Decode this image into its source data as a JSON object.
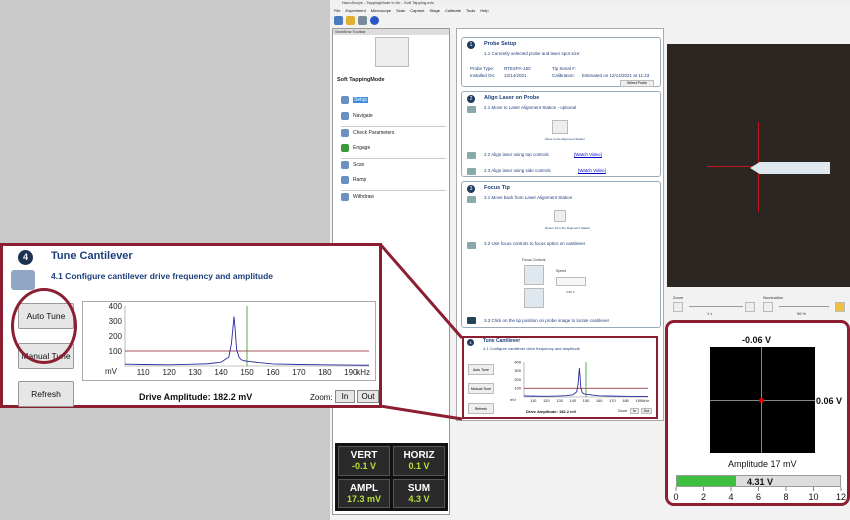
{
  "app": {
    "title": "NanoScope - TappingMode in Air - Soft Tapping.edc"
  },
  "menu": [
    "File",
    "Experiment",
    "Microscope",
    "Scan",
    "Capture",
    "Stage",
    "Calibrate",
    "Tools",
    "Help"
  ],
  "workflow": {
    "header": "Workflow Toolbar",
    "title": "Soft TappingMode",
    "items": [
      "Setup",
      "Navigate",
      "Check Parameters",
      "Engage",
      "Scan",
      "Ramp",
      "Withdraw"
    ]
  },
  "readouts": [
    {
      "label": "VERT",
      "value": "-0.1  V"
    },
    {
      "label": "HORIZ",
      "value": "0.1  V"
    },
    {
      "label": "AMPL",
      "value": "17.3  mV"
    },
    {
      "label": "SUM",
      "value": "4.3  V"
    }
  ],
  "steps": {
    "s1": {
      "num": "1",
      "title": "Probe Setup",
      "t1": "1.1 Currently selected probe and laser spot size:",
      "type_label": "Probe Type:",
      "type_value": "RTESPA-150",
      "serial_label": "Tip Serial #:",
      "inst_label": "Installed On:",
      "inst_value": "12/14/2021",
      "cal_label": "Calibration:",
      "cal_value": "Estimated on 12/14/2021 at 11:23",
      "select": "Select Probe"
    },
    "s2": {
      "num": "2",
      "title": "Align Laser on Probe",
      "t1": "2.1 Move to Laser Alignment Station - optional",
      "move": "Move to the Alignment Station",
      "t2": "2.2 Align laser using top controls",
      "t3": "2.3 Align laser using side controls",
      "video": "[Watch Video]"
    },
    "s3": {
      "num": "3",
      "title": "Focus Tip",
      "t1": "3.1 Move back from Laser Alignment Station",
      "ret": "Return from the Alignment Station",
      "t2": "3.2 Use focus controls to focus optics on cantilever",
      "fc": "Focus Controls",
      "speed": "Speed",
      "speedval": "2.00 X",
      "t3": "3.3 Click on the tip position on probe image to locate cantilever"
    },
    "s4": {
      "num": "4",
      "title": "Tune Cantilever",
      "t1": "4.1 Configure cantilever drive frequency and amplitude",
      "auto": "Auto Tune",
      "manual": "Manual Tune",
      "refresh": "Refresh",
      "drive": "Drive Amplitude: 182.2 mV",
      "zoom": "Zoom:",
      "in": "In",
      "out": "Out"
    }
  },
  "zoom": {
    "zoom_label": "Zoom",
    "zoom_val": "1 x",
    "illum_label": "Illumination",
    "illum_val": "96 %"
  },
  "panel": {
    "top": "-0.06 V",
    "right": "0.06 V",
    "amp": "Amplitude 17 mV",
    "bar_value": "4.31  V",
    "bar_fraction": 0.359,
    "ticks": [
      "0",
      "2",
      "4",
      "6",
      "8",
      "10",
      "12"
    ]
  },
  "colors": {
    "accent": "#8b1e30",
    "trace": "#2a2aa0",
    "green": "#3fbf3f"
  },
  "chart_data": {
    "type": "line",
    "x_ticks": [
      110,
      120,
      130,
      140,
      150,
      160,
      170,
      180,
      190
    ],
    "y_ticks": [
      100,
      200,
      300,
      400
    ],
    "xlabel": "kHz",
    "ylabel": "mV",
    "xlim": [
      103,
      197
    ],
    "ylim": [
      0,
      400
    ],
    "x": [
      103,
      110,
      120,
      128,
      135,
      140,
      143,
      144,
      145,
      145.5,
      146,
      147,
      148,
      149,
      150,
      152,
      155,
      160,
      170,
      180,
      190,
      197
    ],
    "y": [
      12,
      10,
      8,
      11,
      15,
      25,
      60,
      150,
      330,
      230,
      110,
      55,
      40,
      35,
      32,
      28,
      22,
      14,
      10,
      8,
      6,
      5
    ],
    "hline": 100,
    "vline": 150
  }
}
